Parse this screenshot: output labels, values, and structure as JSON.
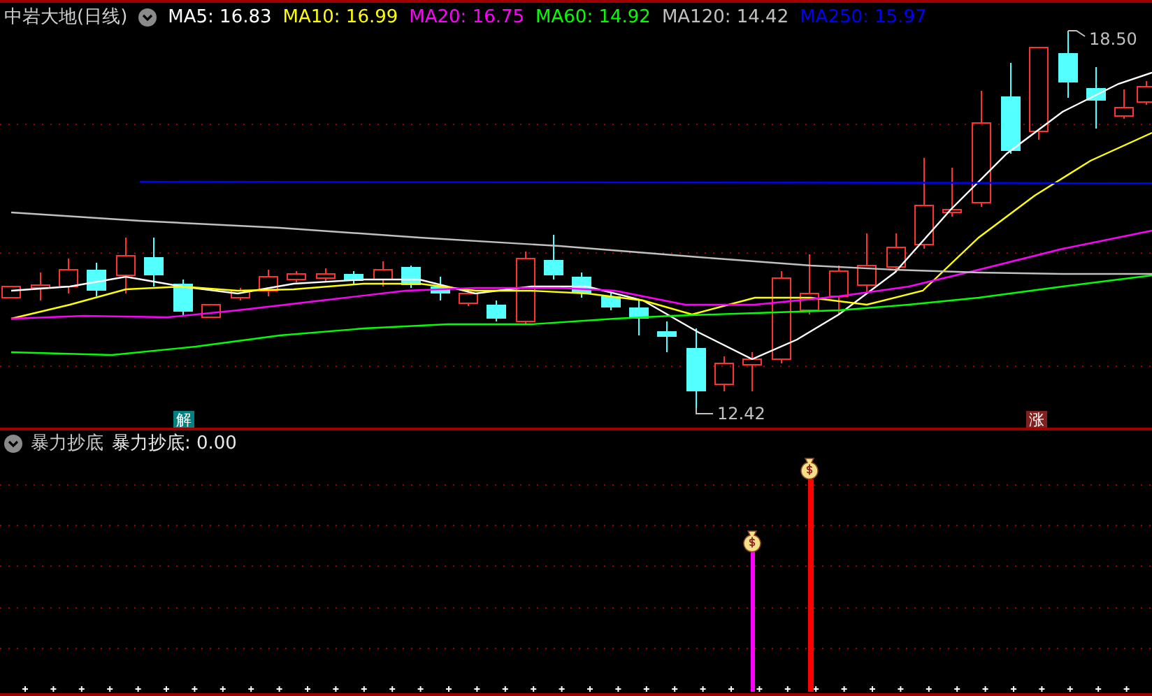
{
  "window": {
    "title": "中岩大地(日线)"
  },
  "ma_legend": [
    {
      "label": "MA5: 16.83",
      "color": "#ffffff"
    },
    {
      "label": "MA10: 16.99",
      "color": "#ffff00"
    },
    {
      "label": "MA20: 16.75",
      "color": "#ff00ff"
    },
    {
      "label": "MA60: 14.92",
      "color": "#00ff00"
    },
    {
      "label": "MA120: 14.42",
      "color": "#c0c0c0"
    },
    {
      "label": "MA250: 15.97",
      "color": "#0000ff"
    }
  ],
  "price_marks": [
    {
      "text": "18.50"
    },
    {
      "text": "12.42"
    }
  ],
  "signal_tags": [
    {
      "text": "解",
      "kind": "buy"
    },
    {
      "text": "涨",
      "kind": "rise"
    }
  ],
  "indicator": {
    "name": "暴力抄底",
    "reading": "暴力抄底: 0.00"
  }
}
